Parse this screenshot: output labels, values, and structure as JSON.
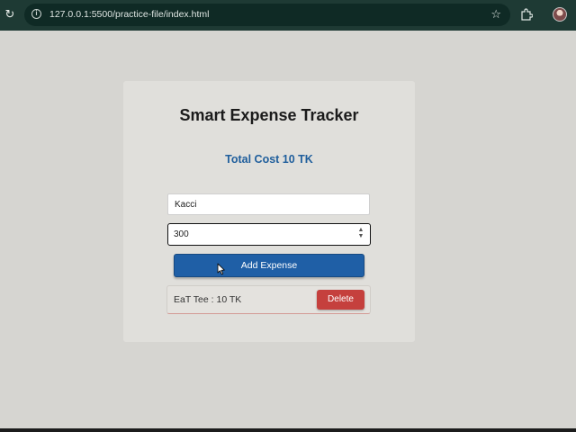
{
  "browser": {
    "url": "127.0.0.1:5500/practice-file/index.html",
    "reload_icon": "reload-icon",
    "site_info_icon": "info-icon",
    "bookmark_icon": "star-icon",
    "extensions_icon": "puzzle-icon"
  },
  "app": {
    "title": "Smart Expense Tracker",
    "total_label": "Total Cost 10 TK",
    "name_input": {
      "value": "Kacci"
    },
    "amount_input": {
      "value": "300"
    },
    "add_button_label": "Add Expense",
    "expenses": [
      {
        "text": "EaT Tee : 10 TK",
        "delete_label": "Delete"
      }
    ]
  },
  "colors": {
    "page_background": "#d6d5d1",
    "card_background": "#e0dfdb",
    "accent_blue": "#1f5fa6",
    "total_text": "#1f5e9c",
    "delete_red": "#c5403d",
    "browser_bar": "#1e3a34"
  }
}
